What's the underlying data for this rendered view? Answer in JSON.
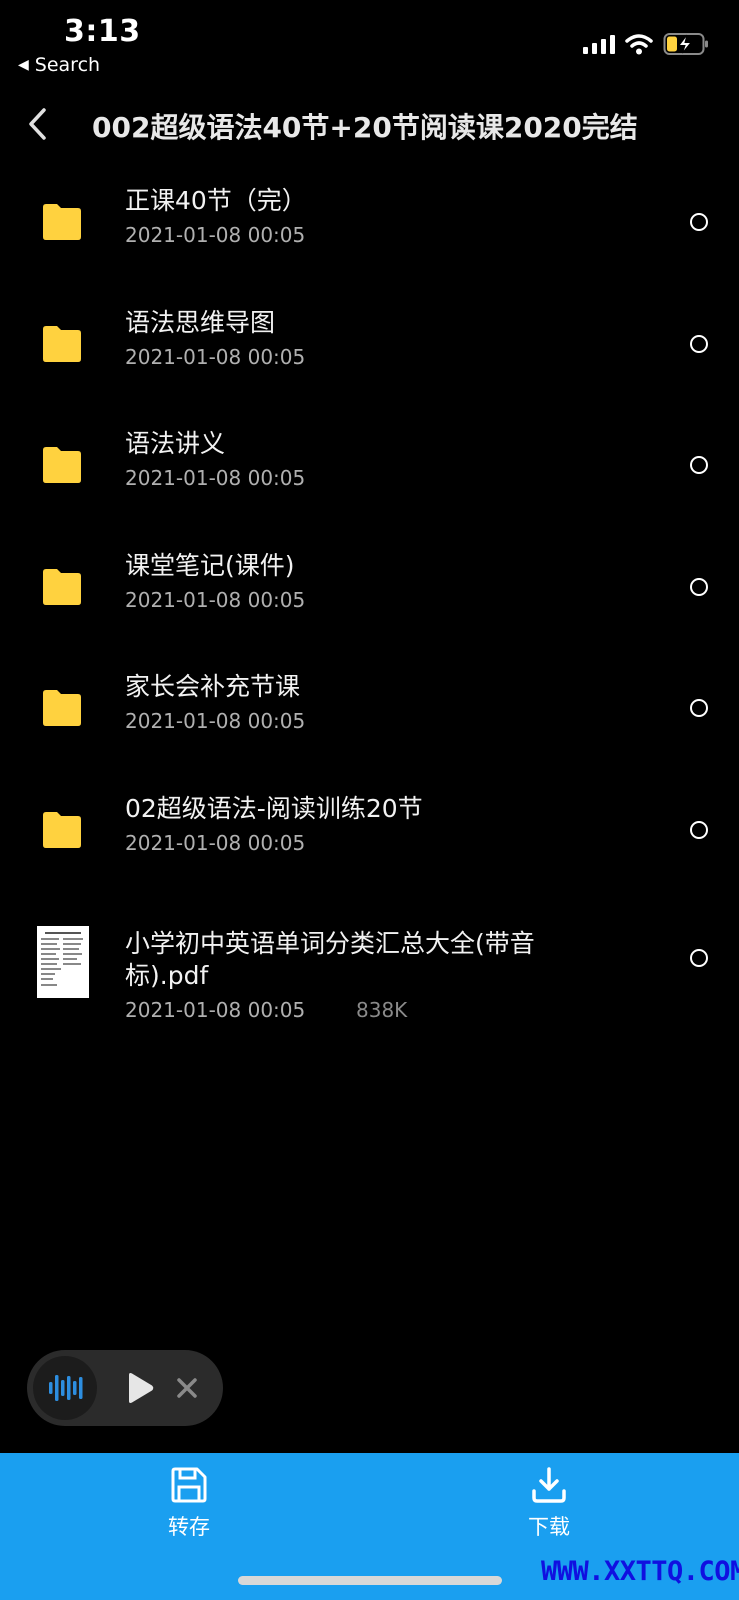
{
  "status_bar": {
    "time": "3:13",
    "back_app_label": "Search",
    "icons": [
      "cellular-signal-icon",
      "wifi-icon",
      "battery-charging-icon"
    ]
  },
  "header": {
    "title": "002超级语法40节+20节阅读课2020完结"
  },
  "files": [
    {
      "name": "正课40节（完）",
      "date": "2021-01-08 00:05",
      "type": "folder"
    },
    {
      "name": "语法思维导图",
      "date": "2021-01-08 00:05",
      "type": "folder"
    },
    {
      "name": "语法讲义",
      "date": "2021-01-08 00:05",
      "type": "folder"
    },
    {
      "name": "课堂笔记(课件)",
      "date": "2021-01-08 00:05",
      "type": "folder"
    },
    {
      "name": "家长会补充节课",
      "date": "2021-01-08 00:05",
      "type": "folder"
    },
    {
      "name": "02超级语法-阅读训练20节",
      "date": "2021-01-08 00:05",
      "type": "folder"
    },
    {
      "name": "小学初中英语单词分类汇总大全(带音标).pdf",
      "date": "2021-01-08 00:05",
      "size": "838K",
      "type": "pdf"
    }
  ],
  "bottom_bar": {
    "save_label": "转存",
    "download_label": "下载"
  },
  "colors": {
    "folder": "#ffd23f",
    "bottom_bar": "#1a9ff0",
    "audio_accent": "#2d8ee0",
    "watermark": "#1010e0"
  },
  "watermark": "WWW.XXTTQ.COM"
}
